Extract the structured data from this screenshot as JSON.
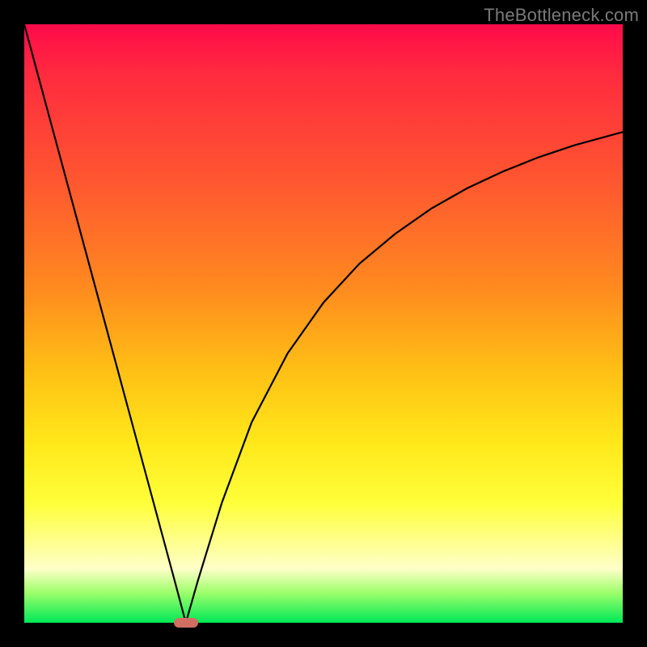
{
  "watermark": "TheBottleneck.com",
  "colors": {
    "curve": "#000000",
    "marker": "#d26e62"
  },
  "chart_data": {
    "type": "line",
    "title": "",
    "xlabel": "",
    "ylabel": "",
    "xlim": [
      0,
      100
    ],
    "ylim": [
      0,
      100
    ],
    "grid": false,
    "marker": {
      "x": 27,
      "y": 0
    },
    "series": [
      {
        "name": "curve",
        "x": [
          0,
          5,
          10,
          15,
          20,
          25,
          27,
          29,
          33,
          38,
          44,
          50,
          56,
          62,
          68,
          74,
          80,
          86,
          92,
          100
        ],
        "y": [
          100,
          81.5,
          63,
          44.5,
          26,
          7.5,
          0,
          7,
          20,
          33.5,
          45,
          53.5,
          60,
          65,
          69.2,
          72.6,
          75.4,
          77.8,
          79.8,
          82
        ]
      }
    ]
  }
}
